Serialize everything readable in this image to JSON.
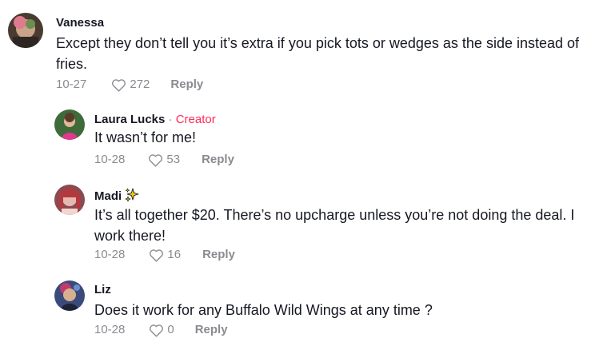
{
  "comments": [
    {
      "username": "Vanessa",
      "text": "Except they don’t tell you it’s extra if you pick tots or wedges as the side instead of fries.",
      "date": "10-27",
      "likes": "272",
      "reply_label": "Reply",
      "avatar": "avatar-photo"
    },
    {
      "username": "Laura Lucks",
      "separator": " · ",
      "creator_label": "Creator",
      "text": "It wasn’t for me!",
      "date": "10-28",
      "likes": "53",
      "reply_label": "Reply",
      "avatar": "avatar-photo"
    },
    {
      "username": "Madi",
      "username_icon": "sparkles-icon",
      "text": "It’s all together $20. There’s no upcharge unless you’re not doing the deal. I work there!",
      "date": "10-28",
      "likes": "16",
      "reply_label": "Reply",
      "avatar": "avatar-photo"
    },
    {
      "username": "Liz",
      "text": "Does it work for any Buffalo Wild Wings at any time ?",
      "date": "10-28",
      "likes": "0",
      "reply_label": "Reply",
      "avatar": "avatar-photo"
    }
  ],
  "colors": {
    "text": "#161823",
    "muted": "#8a8b91",
    "creator": "#fe2c55"
  },
  "icons": {
    "like": "heart-outline-icon"
  }
}
